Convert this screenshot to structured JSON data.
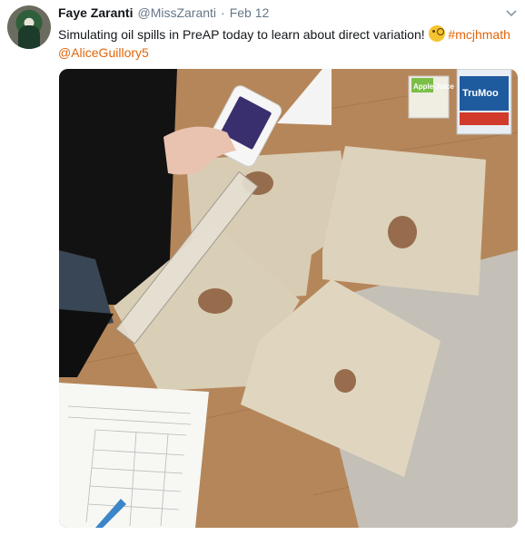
{
  "tweet": {
    "author_name": "Faye Zaranti",
    "handle": "@MissZaranti",
    "separator": "·",
    "date": "Feb 12",
    "text_main": "Simulating oil spills in PreAP today to learn about direct variation! ",
    "hashtag": "#mcjhmath",
    "mention": "@AliceGuillory5"
  },
  "photo": {
    "juice_box_label": "Apple Juice",
    "milk_carton_label": "TruMoo"
  },
  "colors": {
    "link": "#e0660a",
    "name": "#14171a",
    "meta": "#657786"
  },
  "icons": [
    "chevron-down-icon",
    "thinking-face-icon"
  ]
}
